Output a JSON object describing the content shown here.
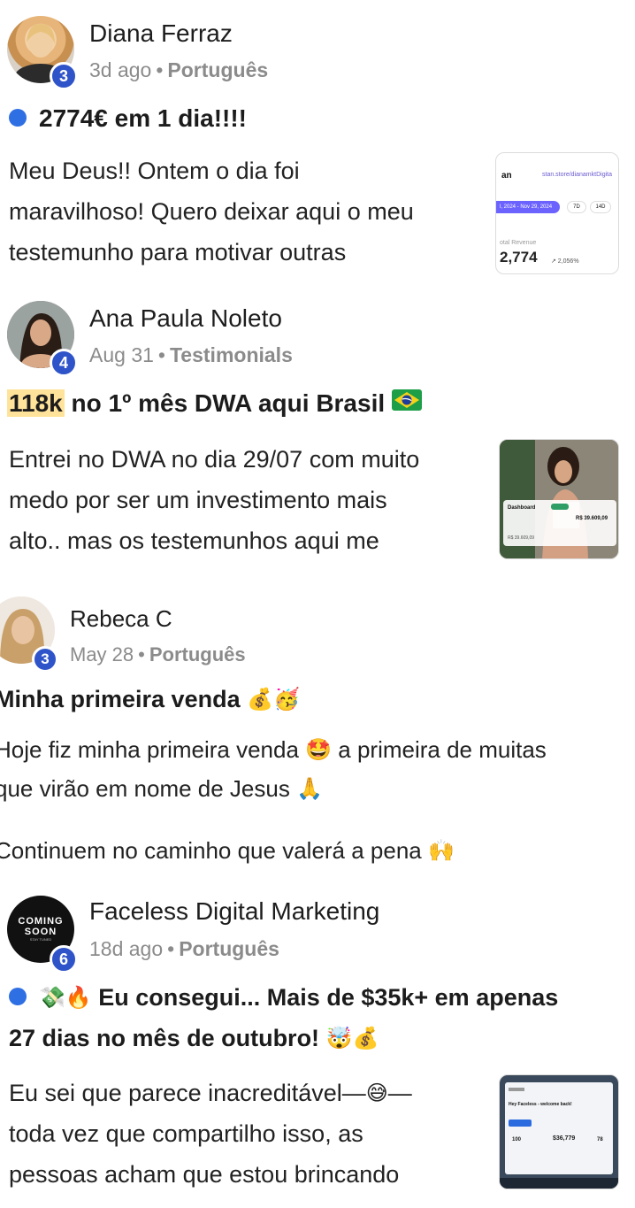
{
  "posts": [
    {
      "author": "Diana Ferraz",
      "level": "3",
      "time": "3d ago",
      "separator": "•",
      "category": "Português",
      "title": "2774€ em 1 dia!!!!",
      "body": [
        "Meu Deus!! Ontem o dia foi",
        "maravilhoso! Quero deixar aqui o meu",
        "testemunho para motivar outras"
      ],
      "thumb": {
        "brand": "an",
        "url": "stan.store/dianamktDigita",
        "range": "l, 2024 - Nov 29, 2024",
        "btn1": "7D",
        "btn2": "14D",
        "label": "otal Revenue",
        "value": "2,774",
        "delta": "↗ 2,056%"
      }
    },
    {
      "author": "Ana Paula Noleto",
      "level": "4",
      "time": "Aug 31",
      "separator": "•",
      "category": "Testimonials",
      "title_highlight": "118k",
      "title_rest": " no 1º mês DWA aqui Brasil ",
      "flag_icon": "brazil-flag-icon",
      "body": [
        "Entrei no DWA no dia 29/07 com muito",
        "medo por ser um investimento mais",
        "alto.. mas os testemunhos aqui me"
      ],
      "thumb": {
        "title": "Dashboard",
        "amount": "R$ 39.609,09",
        "amount2": "R$ 39.609,09"
      }
    },
    {
      "author": "Rebeca C",
      "level": "3",
      "time": "May 28",
      "separator": "•",
      "category": "Português",
      "title": "Minha primeira venda",
      "title_emojis": "💰🥳",
      "body": [
        {
          "text": "Hoje fiz minha primeira venda ",
          "emoji": "🤩",
          "after": " a primeira de muitas"
        },
        {
          "text": "que virão em nome de Jesus ",
          "emoji": "🙏",
          "after": ""
        },
        {
          "text": "Continuem no caminho que valerá a pena ",
          "emoji": "🙌",
          "after": ""
        }
      ]
    },
    {
      "author": "Faceless Digital Marketing",
      "level": "6",
      "time": "18d ago",
      "separator": "•",
      "category": "Português",
      "avatar_text": [
        "COMING",
        "SOON",
        "STAY TUNED"
      ],
      "title_emojis": "💸🔥",
      "title_line1": " Eu consegui... Mais de $35k+ em apenas",
      "title_line2": "27 dias no mês de outubro! ",
      "title_line2_emojis": "🤯💰",
      "body": [
        {
          "text": "Eu sei que parece inacreditável—",
          "emoji": "😅",
          "after": "—"
        },
        {
          "text": "toda vez que compartilho isso, as",
          "emoji": "",
          "after": ""
        },
        {
          "text": "pessoas acham que estou brincando",
          "emoji": "",
          "after": ""
        }
      ],
      "thumb": {
        "title": "Hey Faceless - welcome back!",
        "stat1": "100",
        "stat2": "$36,779",
        "stat3": "78"
      }
    }
  ],
  "colors": {
    "badge": "#2f54c9",
    "unread_dot": "#2f6fe4",
    "highlight": "#ffe39a",
    "meta": "#8b8b8b"
  }
}
